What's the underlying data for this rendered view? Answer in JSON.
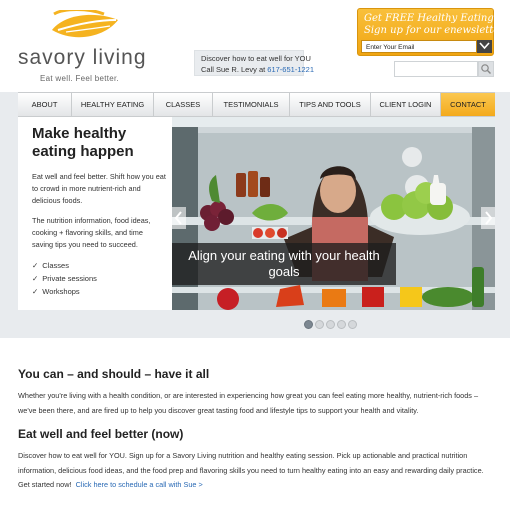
{
  "brand": {
    "name": "savory living",
    "tagline": "Eat well. Feel better.",
    "accent": "#f5b320",
    "link_color": "#2a6ab5"
  },
  "contact": {
    "line1": "Discover how to eat well for YOU",
    "line2_prefix": "Call Sue R. Levy at",
    "phone": "617-651-1221"
  },
  "newsletter": {
    "line1": "Get FREE Healthy Eating Ideas",
    "line2": "Sign up for our enewsletter",
    "placeholder": "Enter Your Email",
    "submit_icon": "arrow-submit-icon"
  },
  "search": {
    "value": "",
    "icon": "search-icon"
  },
  "nav": {
    "items": [
      {
        "label": "ABOUT",
        "active": false
      },
      {
        "label": "HEALTHY EATING",
        "active": false
      },
      {
        "label": "CLASSES",
        "active": false
      },
      {
        "label": "TESTIMONIALS",
        "active": false
      },
      {
        "label": "TIPS AND TOOLS",
        "active": false
      },
      {
        "label": "CLIENT LOGIN",
        "active": false
      },
      {
        "label": "CONTACT",
        "active": true
      }
    ]
  },
  "hero": {
    "title": "Make healthy eating happen",
    "p1": "Eat well and feel better. Shift how you eat to crowd in more nutrient-rich and delicious foods.",
    "p2": "The nutrition information, food ideas, cooking + flavoring skills, and time saving tips you need to succeed.",
    "list": [
      "Classes",
      "Private sessions",
      "Workshops"
    ],
    "caption": "Align your eating with your health goals",
    "slide_count": 5,
    "active_slide": 1
  },
  "section1": {
    "title": "You can – and should – have it all",
    "body": "Whether you're living with a health condition, or are interested in experiencing how great you can feel eating more healthy, nutrient-rich foods – we've been there, and are fired up to help you discover great tasting food and lifestyle tips to support your health and vitality."
  },
  "section2": {
    "title": "Eat well and feel better (now)",
    "body": "Discover how to eat well for YOU. Sign up for a Savory Living nutrition and healthy eating session. Pick up actionable and practical nutrition information, delicious food ideas, and the food prep and flavoring skills you need to turn healthy eating into an easy and rewarding daily practice. Get started now!",
    "link": "Click here to schedule a call with Sue >"
  }
}
